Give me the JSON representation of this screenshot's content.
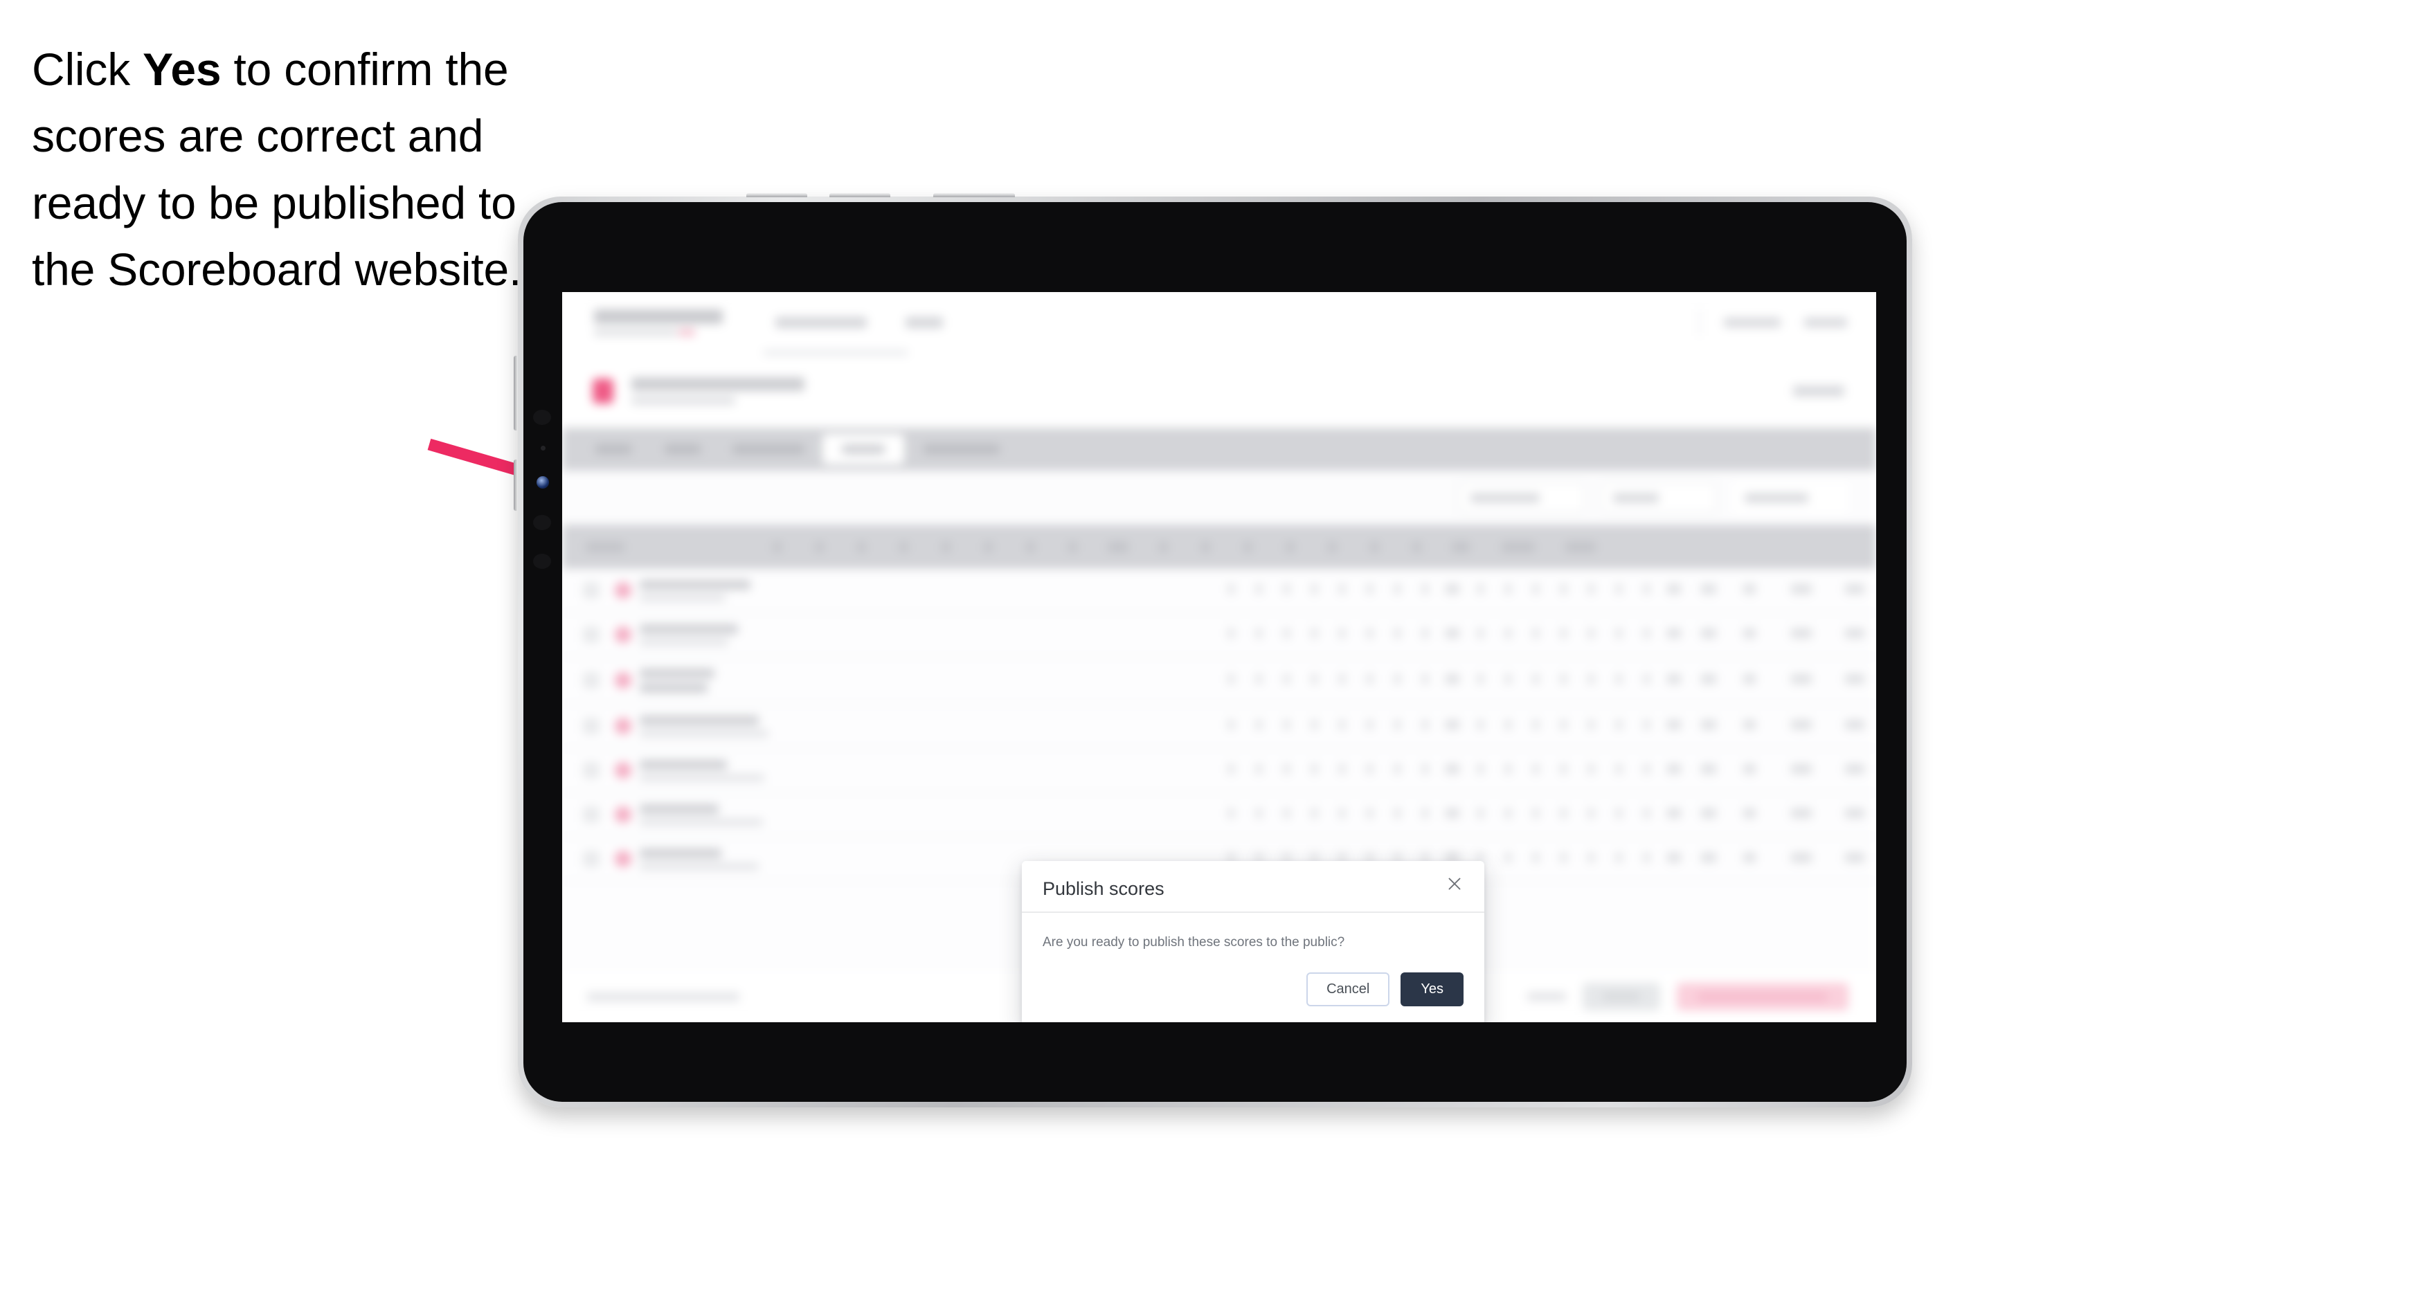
{
  "caption": {
    "before": "Click ",
    "emphasis": "Yes",
    "after": " to confirm the scores are correct and ready to be published to the Scoreboard website."
  },
  "annotation": {
    "arrow_color": "#ED2A62",
    "arrow_name": "pointer-arrow"
  },
  "device": {
    "type": "tablet",
    "bezel_color": "#c9cacd",
    "body_color": "#0c0c0d"
  },
  "app": {
    "brand": "SCOREBOARD",
    "nav": [
      "Tournaments",
      "Help"
    ],
    "top_right": [
      "Get help",
      "Menu"
    ],
    "page_title": "Tournament",
    "tabs": [
      "Details",
      "Format",
      "Course/Holes",
      "Results",
      "Leaderboard"
    ],
    "active_tab": "Results",
    "filters": [
      "Filter scores",
      "Round",
      "Export data"
    ],
    "table_header_first": "Player",
    "table_header_last": [
      "Points",
      "Total"
    ],
    "footer_note": "Scores not yet published",
    "footer_buttons": [
      "Cancel",
      "Save",
      "Publish scores to public"
    ]
  },
  "modal": {
    "title": "Publish scores",
    "body": "Are you ready to publish these scores to the public?",
    "cancel_label": "Cancel",
    "confirm_label": "Yes",
    "close_icon": "close-icon",
    "confirm_color": "#2B3648",
    "cancel_border_color": "#CCD6EA"
  }
}
